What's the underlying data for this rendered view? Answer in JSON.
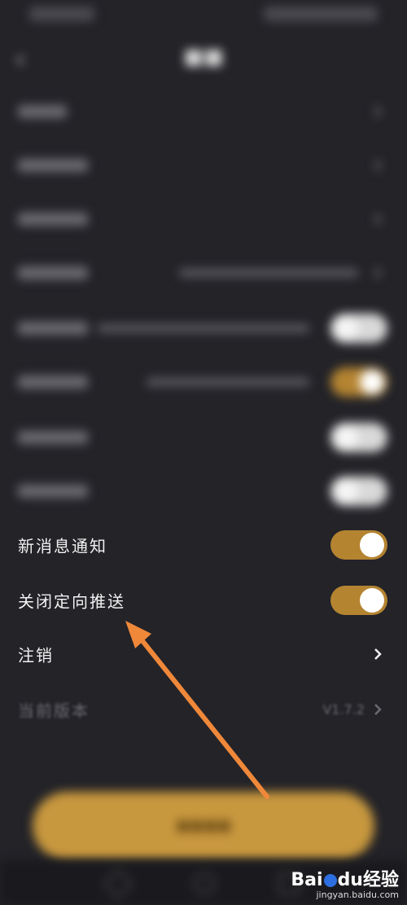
{
  "settings": {
    "items": [
      {
        "label": "新消息通知",
        "toggle": "on"
      },
      {
        "label": "关闭定向推送",
        "toggle": "on"
      },
      {
        "label": "注销"
      },
      {
        "label": "当前版本",
        "value": "V1.7.2"
      }
    ]
  },
  "watermark": {
    "logo_bai": "Bai",
    "logo_du": "du",
    "logo_jingyan": "经验",
    "url": "jingyan.baidu.com"
  },
  "colors": {
    "background": "#232328",
    "toggle_on": "#b48431",
    "button": "#c8983e",
    "arrow": "#f0883a"
  },
  "icons": {
    "back": "chevron-left-icon",
    "chevron": "chevron-right-icon"
  }
}
